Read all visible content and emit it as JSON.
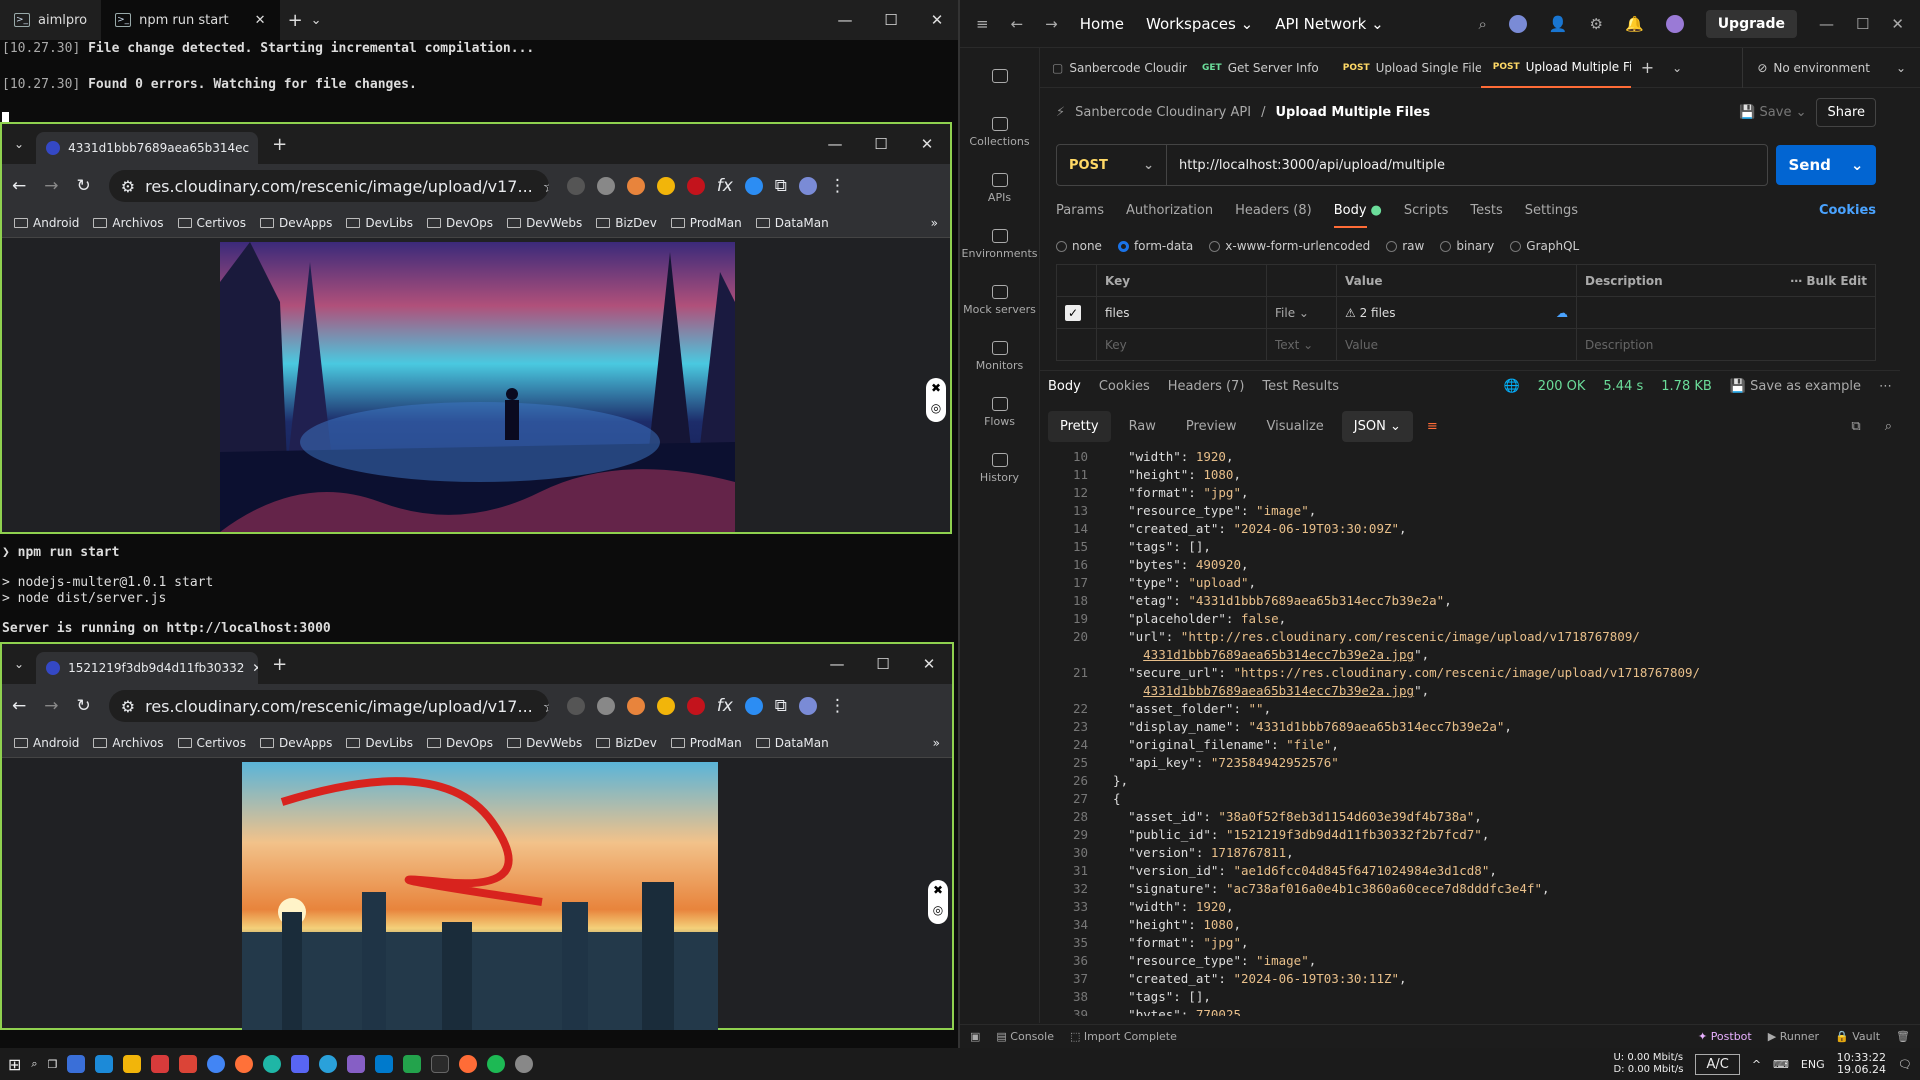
{
  "terminal": {
    "tabs": [
      "aimlpro",
      "npm run start"
    ],
    "top_lines": [
      {
        "time": "[10.27.30]",
        "text": " File change detected. Starting incremental compilation..."
      },
      {
        "time": "[10.27.30]",
        "text": " Found 0 errors. Watching for file changes."
      }
    ],
    "mid_lines": [
      "npm run start",
      "",
      "> nodejs-multer@1.0.1 start",
      "> node dist/server.js",
      "",
      "Server is running on http://localhost:3000"
    ]
  },
  "browser1": {
    "tab_title": "4331d1bbb7689aea65b314ec",
    "url": "res.cloudinary.com/rescenic/image/upload/v17...",
    "bookmarks": [
      "Android",
      "Archivos",
      "Certivos",
      "DevApps",
      "DevLibs",
      "DevOps",
      "DevWebs",
      "BizDev",
      "ProdMan",
      "DataMan"
    ]
  },
  "browser2": {
    "tab_title": "1521219f3db9d4d11fb30332",
    "url": "res.cloudinary.com/rescenic/image/upload/v17...",
    "bookmarks": [
      "Android",
      "Archivos",
      "Certivos",
      "DevApps",
      "DevLibs",
      "DevOps",
      "DevWebs",
      "BizDev",
      "ProdMan",
      "DataMan"
    ]
  },
  "postman": {
    "nav": {
      "home": "Home",
      "workspaces": "Workspaces",
      "api_network": "API Network",
      "upgrade": "Upgrade"
    },
    "rail": [
      "Collections",
      "APIs",
      "Environments",
      "Mock servers",
      "Monitors",
      "Flows",
      "History"
    ],
    "tabs": [
      {
        "method": "",
        "label": "Sanbercode Cloudir"
      },
      {
        "method": "GET",
        "label": "Get Server Info"
      },
      {
        "method": "POST",
        "label": "Upload Single File"
      },
      {
        "method": "POST",
        "label": "Upload Multiple Fi"
      }
    ],
    "environment": "No environment",
    "breadcrumb": {
      "collection": "Sanbercode Cloudinary API",
      "request": "Upload Multiple Files"
    },
    "save": "Save",
    "share": "Share",
    "method": "POST",
    "url": "http://localhost:3000/api/upload/multiple",
    "send": "Send",
    "request_tabs": [
      "Params",
      "Authorization",
      "Headers (8)",
      "Body",
      "Scripts",
      "Tests",
      "Settings"
    ],
    "cookies": "Cookies",
    "body_types": [
      "none",
      "form-data",
      "x-www-form-urlencoded",
      "raw",
      "binary",
      "GraphQL"
    ],
    "kv_headers": {
      "key": "Key",
      "value": "Value",
      "description": "Description",
      "bulk": "Bulk Edit"
    },
    "kv_row": {
      "key": "files",
      "type": "File",
      "value": "2 files"
    },
    "kv_empty": {
      "key": "Key",
      "type": "Text",
      "value": "Value",
      "description": "Description"
    },
    "response_tabs": [
      "Body",
      "Cookies",
      "Headers (7)",
      "Test Results"
    ],
    "status": "200 OK",
    "time": "5.44 s",
    "size": "1.78 KB",
    "save_example": "Save as example",
    "view_tabs": [
      "Pretty",
      "Raw",
      "Preview",
      "Visualize"
    ],
    "format": "JSON",
    "code": [
      {
        "n": "10",
        "t": "    \"width\": 1920,"
      },
      {
        "n": "11",
        "t": "    \"height\": 1080,"
      },
      {
        "n": "12",
        "t": "    \"format\": \"jpg\","
      },
      {
        "n": "13",
        "t": "    \"resource_type\": \"image\","
      },
      {
        "n": "14",
        "t": "    \"created_at\": \"2024-06-19T03:30:09Z\","
      },
      {
        "n": "15",
        "t": "    \"tags\": [],"
      },
      {
        "n": "16",
        "t": "    \"bytes\": 490920,"
      },
      {
        "n": "17",
        "t": "    \"type\": \"upload\","
      },
      {
        "n": "18",
        "t": "    \"etag\": \"4331d1bbb7689aea65b314ecc7b39e2a\","
      },
      {
        "n": "19",
        "t": "    \"placeholder\": false,"
      },
      {
        "n": "20",
        "t": "    \"url\": \"http://res.cloudinary.com/rescenic/image/upload/v1718767809/"
      },
      {
        "n": "",
        "t": "      4331d1bbb7689aea65b314ecc7b39e2a.jpg\","
      },
      {
        "n": "21",
        "t": "    \"secure_url\": \"https://res.cloudinary.com/rescenic/image/upload/v1718767809/"
      },
      {
        "n": "",
        "t": "      4331d1bbb7689aea65b314ecc7b39e2a.jpg\","
      },
      {
        "n": "22",
        "t": "    \"asset_folder\": \"\","
      },
      {
        "n": "23",
        "t": "    \"display_name\": \"4331d1bbb7689aea65b314ecc7b39e2a\","
      },
      {
        "n": "24",
        "t": "    \"original_filename\": \"file\","
      },
      {
        "n": "25",
        "t": "    \"api_key\": \"723584942952576\""
      },
      {
        "n": "26",
        "t": "  },"
      },
      {
        "n": "27",
        "t": "  {"
      },
      {
        "n": "28",
        "t": "    \"asset_id\": \"38a0f52f8eb3d1154d603e39df4b738a\","
      },
      {
        "n": "29",
        "t": "    \"public_id\": \"1521219f3db9d4d11fb30332f2b7fcd7\","
      },
      {
        "n": "30",
        "t": "    \"version\": 1718767811,"
      },
      {
        "n": "31",
        "t": "    \"version_id\": \"ae1d6fcc04d845f6471024984e3d1cd8\","
      },
      {
        "n": "32",
        "t": "    \"signature\": \"ac738af016a0e4b1c3860a60cece7d8dddfc3e4f\","
      },
      {
        "n": "33",
        "t": "    \"width\": 1920,"
      },
      {
        "n": "34",
        "t": "    \"height\": 1080,"
      },
      {
        "n": "35",
        "t": "    \"format\": \"jpg\","
      },
      {
        "n": "36",
        "t": "    \"resource_type\": \"image\","
      },
      {
        "n": "37",
        "t": "    \"created_at\": \"2024-06-19T03:30:11Z\","
      },
      {
        "n": "38",
        "t": "    \"tags\": [],"
      },
      {
        "n": "39",
        "t": "    \"bytes\": 770025,"
      }
    ],
    "statusbar": [
      "Console",
      "Import Complete",
      "Postbot",
      "Runner",
      "Vault"
    ]
  },
  "taskbar": {
    "net_up": "0.00 Mbit/s",
    "net_down": "0.00 Mbit/s",
    "ac": "A/C",
    "lang": "ENG",
    "time": "10:33:22",
    "date": "19.06.24",
    "u": "U:",
    "d": "D:"
  }
}
